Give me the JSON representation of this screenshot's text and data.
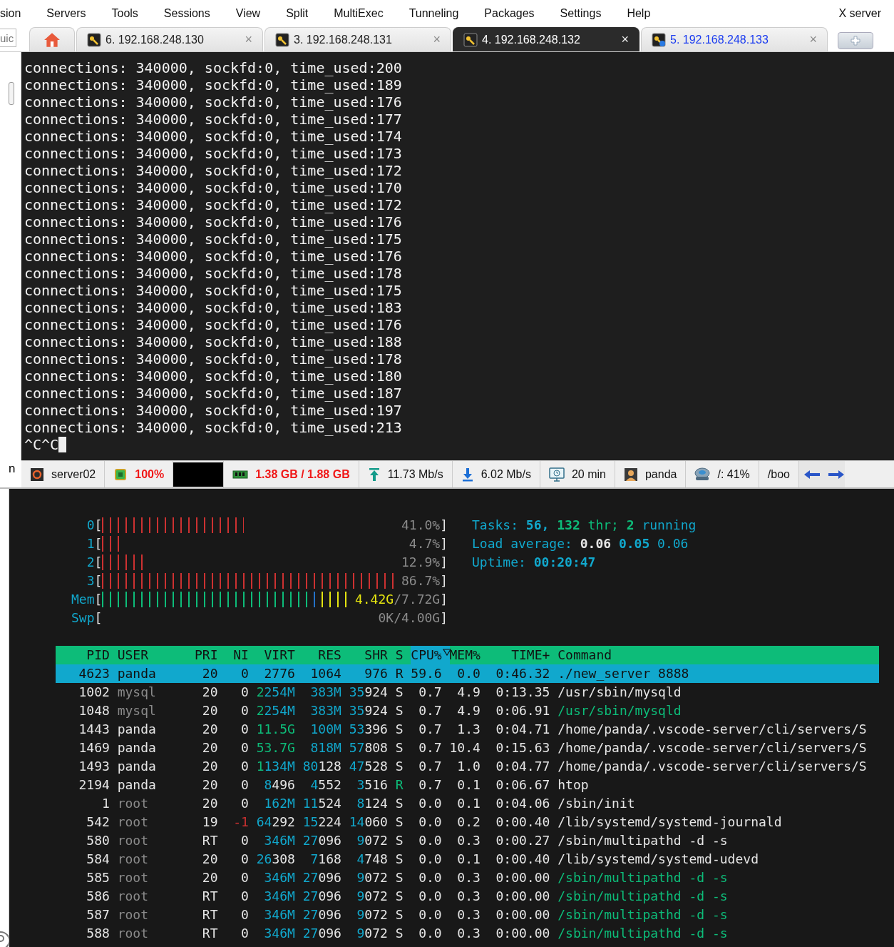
{
  "menu_bar": {
    "items": [
      "sion",
      "Servers",
      "Tools",
      "Sessions",
      "View",
      "Split",
      "MultiExec",
      "Tunneling",
      "Packages",
      "Settings",
      "Help"
    ],
    "right_item": "X server"
  },
  "session_search": {
    "value": "uic"
  },
  "tabs": [
    {
      "kind": "home",
      "selected": false
    },
    {
      "kind": "session",
      "label": "6. 192.168.248.130",
      "close": "×",
      "selected": false,
      "highlighted": false
    },
    {
      "kind": "session",
      "label": "3. 192.168.248.131",
      "close": "×",
      "selected": false,
      "highlighted": false
    },
    {
      "kind": "session",
      "label": "4. 192.168.248.132",
      "close": "×",
      "selected": true,
      "highlighted": false
    },
    {
      "kind": "session",
      "label": "5. 192.168.248.133",
      "close": "×",
      "selected": false,
      "highlighted": true
    }
  ],
  "terminal": {
    "lines": [
      "connections: 340000, sockfd:0, time_used:200",
      "connections: 340000, sockfd:0, time_used:189",
      "connections: 340000, sockfd:0, time_used:176",
      "connections: 340000, sockfd:0, time_used:177",
      "connections: 340000, sockfd:0, time_used:174",
      "connections: 340000, sockfd:0, time_used:173",
      "connections: 340000, sockfd:0, time_used:172",
      "connections: 340000, sockfd:0, time_used:170",
      "connections: 340000, sockfd:0, time_used:172",
      "connections: 340000, sockfd:0, time_used:176",
      "connections: 340000, sockfd:0, time_used:175",
      "connections: 340000, sockfd:0, time_used:176",
      "connections: 340000, sockfd:0, time_used:178",
      "connections: 340000, sockfd:0, time_used:175",
      "connections: 340000, sockfd:0, time_used:183",
      "connections: 340000, sockfd:0, time_used:176",
      "connections: 340000, sockfd:0, time_used:188",
      "connections: 340000, sockfd:0, time_used:178",
      "connections: 340000, sockfd:0, time_used:180",
      "connections: 340000, sockfd:0, time_used:187",
      "connections: 340000, sockfd:0, time_used:197",
      "connections: 340000, sockfd:0, time_used:213"
    ],
    "input": "^C^C"
  },
  "side_label": "n",
  "status_bar": {
    "items": [
      {
        "kind": "server",
        "text": "server02",
        "alert": false
      },
      {
        "kind": "cpu",
        "text": "100%",
        "alert": true
      },
      {
        "kind": "graph"
      },
      {
        "kind": "memory",
        "text": "1.38 GB / 1.88 GB",
        "alert": true
      },
      {
        "kind": "upload",
        "text": "11.73 Mb/s",
        "alert": false
      },
      {
        "kind": "download",
        "text": "6.02 Mb/s",
        "alert": false
      },
      {
        "kind": "uptime",
        "text": "20 min",
        "alert": false
      },
      {
        "kind": "user",
        "text": "panda",
        "alert": false
      },
      {
        "kind": "disk",
        "text": "/: 41%",
        "alert": false
      },
      {
        "kind": "text",
        "text": "/boo",
        "alert": false
      }
    ]
  },
  "htop": {
    "meters": [
      {
        "kind": "cpu",
        "label": "0",
        "open": "[",
        "reading": "41.0%",
        "close": "]"
      },
      {
        "kind": "cpu",
        "label": "1",
        "open": "[",
        "reading": "4.7%",
        "close": "]"
      },
      {
        "kind": "cpu",
        "label": "2",
        "open": "[",
        "reading": "12.9%",
        "close": "]"
      },
      {
        "kind": "cpu",
        "label": "3",
        "open": "[",
        "reading": "86.7%",
        "close": "]"
      },
      {
        "kind": "memory",
        "label": "Mem",
        "open": "[",
        "used": "4.42G",
        "reading": "/7.72G",
        "close": "]"
      },
      {
        "kind": "swap",
        "label": "Swp",
        "open": "[",
        "reading": "0K/4.00G",
        "close": "]"
      }
    ],
    "summary": [
      {
        "parts": [
          {
            "text": "Tasks: ",
            "color": "#11a8cd",
            "strong": false
          },
          {
            "text": "56, ",
            "color": "#11a8cd",
            "strong": true
          },
          {
            "text": "132",
            "color": "#0dbc79",
            "strong": true
          },
          {
            "text": " thr; ",
            "color": "#0dbc79",
            "strong": false
          },
          {
            "text": "2",
            "color": "#0dbc79",
            "strong": true
          },
          {
            "text": " running",
            "color": "#11a8cd",
            "strong": false
          }
        ]
      },
      {
        "parts": [
          {
            "text": "Load average: ",
            "color": "#11a8cd",
            "strong": false
          },
          {
            "text": "0.06 ",
            "color": "#e5e5e5",
            "strong": true
          },
          {
            "text": "0.05 ",
            "color": "#11a8cd",
            "strong": true
          },
          {
            "text": "0.06",
            "color": "#11a8cd",
            "strong": false
          }
        ]
      },
      {
        "parts": [
          {
            "text": "Uptime: ",
            "color": "#11a8cd",
            "strong": false
          },
          {
            "text": "00:20:47",
            "color": "#11a8cd",
            "strong": true
          }
        ]
      }
    ],
    "columns": [
      {
        "label": "PID",
        "selected": false
      },
      {
        "label": "USER",
        "selected": false
      },
      {
        "label": "PRI",
        "selected": false
      },
      {
        "label": "NI",
        "selected": false
      },
      {
        "label": "VIRT",
        "selected": false
      },
      {
        "label": "RES",
        "selected": false
      },
      {
        "label": "SHR",
        "selected": false
      },
      {
        "label": "S",
        "selected": false
      },
      {
        "label": "CPU%",
        "selected": true
      },
      {
        "label": "MEM%",
        "selected": false
      },
      {
        "label": "TIME+",
        "selected": false
      },
      {
        "label": "Command",
        "selected": false
      }
    ],
    "processes": [
      {
        "pid": "4623",
        "user": "panda",
        "pri": "20",
        "ni": "0",
        "virt": "2776",
        "res": "1064",
        "shr": "976",
        "s": "R",
        "cpu": "59.6",
        "mem": "0.0",
        "time": "0:46.32",
        "command": "./new_server 8888",
        "selected": true
      },
      {
        "pid": "1002",
        "user": "mysql",
        "pri": "20",
        "ni": "0",
        "virt": "2254M",
        "res": "383M",
        "shr": "35924",
        "s": "S",
        "cpu": "0.7",
        "mem": "4.9",
        "time": "0:13.35",
        "command": "/usr/sbin/mysqld",
        "selected": false,
        "other_user": true,
        "thread": false,
        "running": false,
        "high_priority": false
      },
      {
        "pid": "1048",
        "user": "mysql",
        "pri": "20",
        "ni": "0",
        "virt": "2254M",
        "res": "383M",
        "shr": "35924",
        "s": "S",
        "cpu": "0.7",
        "mem": "4.9",
        "time": "0:06.91",
        "command": "/usr/sbin/mysqld",
        "selected": false,
        "other_user": true,
        "thread": true,
        "running": false,
        "high_priority": false
      },
      {
        "pid": "1443",
        "user": "panda",
        "pri": "20",
        "ni": "0",
        "virt": "11.5G",
        "res": "100M",
        "shr": "53396",
        "s": "S",
        "cpu": "0.7",
        "mem": "1.3",
        "time": "0:04.71",
        "command": "/home/panda/.vscode-server/cli/servers/S",
        "selected": false,
        "other_user": false,
        "thread": false,
        "running": false,
        "high_priority": false
      },
      {
        "pid": "1469",
        "user": "panda",
        "pri": "20",
        "ni": "0",
        "virt": "53.7G",
        "res": "818M",
        "shr": "57808",
        "s": "S",
        "cpu": "0.7",
        "mem": "10.4",
        "time": "0:15.63",
        "command": "/home/panda/.vscode-server/cli/servers/S",
        "selected": false,
        "other_user": false,
        "thread": false,
        "running": false,
        "high_priority": false
      },
      {
        "pid": "1493",
        "user": "panda",
        "pri": "20",
        "ni": "0",
        "virt": "1134M",
        "res": "80128",
        "shr": "47528",
        "s": "S",
        "cpu": "0.7",
        "mem": "1.0",
        "time": "0:04.77",
        "command": "/home/panda/.vscode-server/cli/servers/S",
        "selected": false,
        "other_user": false,
        "thread": false,
        "running": false,
        "high_priority": false
      },
      {
        "pid": "2194",
        "user": "panda",
        "pri": "20",
        "ni": "0",
        "virt": "8496",
        "res": "4552",
        "shr": "3516",
        "s": "R",
        "cpu": "0.7",
        "mem": "0.1",
        "time": "0:06.67",
        "command": "htop",
        "selected": false,
        "other_user": false,
        "thread": false,
        "running": true,
        "high_priority": false
      },
      {
        "pid": "1",
        "user": "root",
        "pri": "20",
        "ni": "0",
        "virt": "162M",
        "res": "11524",
        "shr": "8124",
        "s": "S",
        "cpu": "0.0",
        "mem": "0.1",
        "time": "0:04.06",
        "command": "/sbin/init",
        "selected": false,
        "other_user": true,
        "thread": false,
        "running": false,
        "high_priority": false
      },
      {
        "pid": "542",
        "user": "root",
        "pri": "19",
        "ni": "-1",
        "virt": "64292",
        "res": "15224",
        "shr": "14060",
        "s": "S",
        "cpu": "0.0",
        "mem": "0.2",
        "time": "0:00.40",
        "command": "/lib/systemd/systemd-journald",
        "selected": false,
        "other_user": true,
        "thread": false,
        "running": false,
        "high_priority": true
      },
      {
        "pid": "580",
        "user": "root",
        "pri": "RT",
        "ni": "0",
        "virt": "346M",
        "res": "27096",
        "shr": "9072",
        "s": "S",
        "cpu": "0.0",
        "mem": "0.3",
        "time": "0:00.27",
        "command": "/sbin/multipathd -d -s",
        "selected": false,
        "other_user": true,
        "thread": false,
        "running": false,
        "high_priority": false
      },
      {
        "pid": "584",
        "user": "root",
        "pri": "20",
        "ni": "0",
        "virt": "26308",
        "res": "7168",
        "shr": "4748",
        "s": "S",
        "cpu": "0.0",
        "mem": "0.1",
        "time": "0:00.40",
        "command": "/lib/systemd/systemd-udevd",
        "selected": false,
        "other_user": true,
        "thread": false,
        "running": false,
        "high_priority": false
      },
      {
        "pid": "585",
        "user": "root",
        "pri": "20",
        "ni": "0",
        "virt": "346M",
        "res": "27096",
        "shr": "9072",
        "s": "S",
        "cpu": "0.0",
        "mem": "0.3",
        "time": "0:00.00",
        "command": "/sbin/multipathd -d -s",
        "selected": false,
        "other_user": true,
        "thread": true,
        "running": false,
        "high_priority": false
      },
      {
        "pid": "586",
        "user": "root",
        "pri": "RT",
        "ni": "0",
        "virt": "346M",
        "res": "27096",
        "shr": "9072",
        "s": "S",
        "cpu": "0.0",
        "mem": "0.3",
        "time": "0:00.00",
        "command": "/sbin/multipathd -d -s",
        "selected": false,
        "other_user": true,
        "thread": true,
        "running": false,
        "high_priority": false
      },
      {
        "pid": "587",
        "user": "root",
        "pri": "RT",
        "ni": "0",
        "virt": "346M",
        "res": "27096",
        "shr": "9072",
        "s": "S",
        "cpu": "0.0",
        "mem": "0.3",
        "time": "0:00.00",
        "command": "/sbin/multipathd -d -s",
        "selected": false,
        "other_user": true,
        "thread": true,
        "running": false,
        "high_priority": false
      },
      {
        "pid": "588",
        "user": "root",
        "pri": "RT",
        "ni": "0",
        "virt": "346M",
        "res": "27096",
        "shr": "9072",
        "s": "S",
        "cpu": "0.0",
        "mem": "0.3",
        "time": "0:00.00",
        "command": "/sbin/multipathd -d -s",
        "selected": false,
        "other_user": true,
        "thread": true,
        "running": false,
        "high_priority": false
      }
    ]
  }
}
